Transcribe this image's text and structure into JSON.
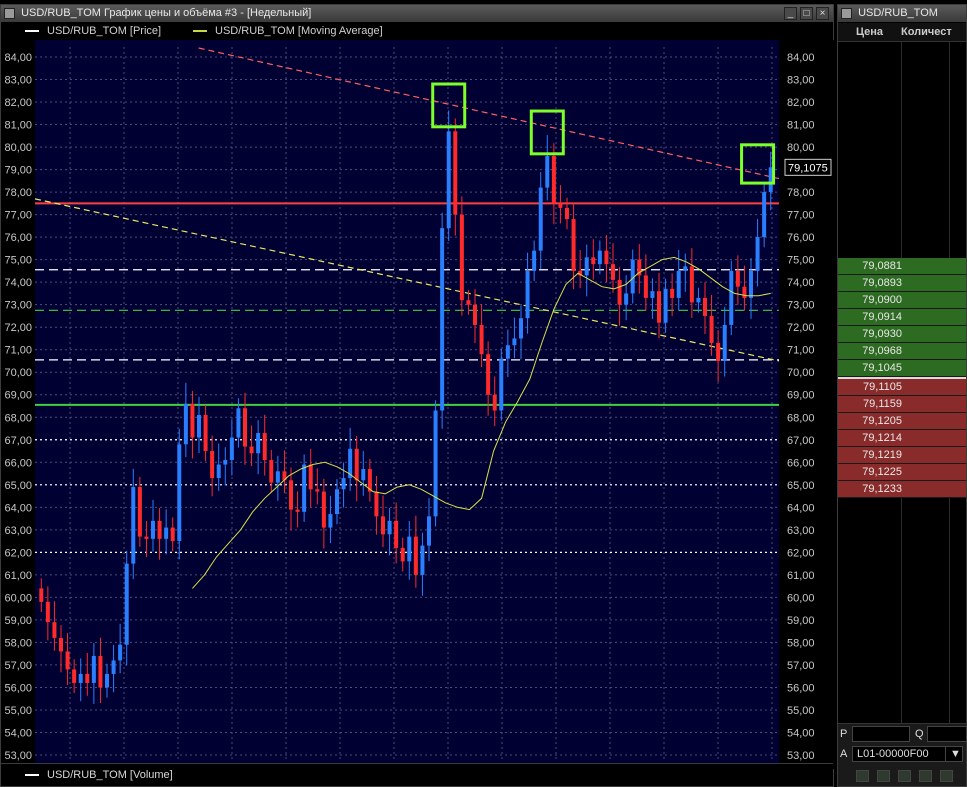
{
  "chart_window": {
    "title": "USD/RUB_TOM График цены и объёма #3 - [Недельный]",
    "legend": [
      {
        "label": "USD/RUB_TOM [Price]",
        "color": "#ffffff"
      },
      {
        "label": "USD/RUB_TOM [Moving Average]",
        "color": "#c8d840"
      }
    ],
    "volume_label": "USD/RUB_TOM [Volume]",
    "last_price": "79,1075"
  },
  "chart_data": {
    "type": "candlestick",
    "ylim": [
      53,
      84
    ],
    "yticks": [
      "53,00",
      "54,00",
      "55,00",
      "56,00",
      "57,00",
      "58,00",
      "59,00",
      "60,00",
      "61,00",
      "62,00",
      "63,00",
      "64,00",
      "65,00",
      "66,00",
      "67,00",
      "68,00",
      "69,00",
      "70,00",
      "71,00",
      "72,00",
      "73,00",
      "74,00",
      "75,00",
      "76,00",
      "77,00",
      "78,00",
      "79,00",
      "80,00",
      "81,00",
      "82,00",
      "83,00",
      "84,00"
    ],
    "close_series": [
      59.8,
      58.9,
      58.2,
      57.6,
      56.8,
      56.2,
      56.6,
      56.2,
      57.4,
      56.0,
      56.6,
      57.2,
      57.9,
      61.5,
      64.9,
      62.7,
      62.6,
      63.4,
      62.6,
      63.1,
      62.5,
      66.8,
      68.6,
      67.1,
      68.1,
      66.5,
      65.3,
      65.9,
      66.1,
      67.1,
      68.4,
      66.7,
      66.4,
      67.3,
      66.1,
      65.1,
      65.6,
      65.2,
      63.9,
      63.8,
      65.9,
      64.8,
      64.7,
      63.1,
      63.7,
      64.8,
      65.3,
      66.6,
      65.2,
      65.7,
      64.7,
      63.6,
      62.8,
      63.4,
      62.2,
      61.6,
      62.7,
      61.0,
      62.3,
      63.6,
      68.3,
      76.4,
      80.7,
      77.0,
      73.2,
      73.0,
      72.1,
      70.8,
      69.0,
      68.3,
      70.6,
      71.2,
      71.5,
      72.4,
      74.5,
      75.4,
      78.2,
      79.6,
      77.5,
      77.3,
      76.8,
      74.5,
      74.3,
      75.1,
      74.8,
      75.4,
      74.8,
      74.1,
      73.0,
      73.5,
      75.0,
      74.3,
      73.3,
      73.6,
      72.2,
      73.7,
      73.3,
      74.5,
      74.7,
      73.1,
      73.3,
      72.5,
      71.3,
      70.5,
      72.1,
      74.5,
      73.8,
      73.3,
      74.5,
      76.0,
      78.0,
      79.1
    ],
    "moving_average": [
      60.4,
      61.0,
      61.8,
      62.4,
      63.0,
      63.8,
      64.4,
      64.9,
      65.4,
      65.7,
      65.9,
      66.0,
      65.8,
      65.5,
      65.1,
      64.7,
      64.6,
      64.9,
      65.0,
      64.8,
      64.5,
      64.2,
      64.0,
      63.9,
      64.4,
      66.5,
      67.8,
      68.7,
      69.7,
      71.3,
      72.8,
      73.9,
      74.4,
      74.1,
      73.8,
      73.7,
      73.9,
      74.4,
      74.7,
      75.0,
      75.1,
      74.9,
      74.6,
      74.2,
      73.8,
      73.5,
      73.4,
      73.4,
      73.5
    ],
    "horizontal_levels": [
      {
        "y": 77.5,
        "color": "#ff4040",
        "style": "solid"
      },
      {
        "y": 68.55,
        "color": "#40d040",
        "style": "solid"
      },
      {
        "y": 74.55,
        "color": "#ffffff",
        "style": "dashed"
      },
      {
        "y": 72.75,
        "color": "#40d040",
        "style": "dashed"
      },
      {
        "y": 70.55,
        "color": "#ffffff",
        "style": "dashed"
      },
      {
        "y": 67.0,
        "color": "#ffffff",
        "style": "dotted"
      },
      {
        "y": 65.0,
        "color": "#ffffff",
        "style": "dotted"
      },
      {
        "y": 62.0,
        "color": "#ffffff",
        "style": "dotted"
      }
    ],
    "trend_lines": [
      {
        "from": [
          0.22,
          84.4
        ],
        "to": [
          1.0,
          78.6
        ],
        "color": "#ff6060",
        "style": "dashed"
      },
      {
        "from": [
          0.0,
          77.7
        ],
        "to": [
          1.0,
          70.5
        ],
        "color": "#e8e860",
        "style": "dashed"
      }
    ],
    "highlight_boxes": [
      {
        "x_index": 62,
        "y_range": [
          80.9,
          82.8
        ]
      },
      {
        "x_index": 77,
        "y_range": [
          79.7,
          81.6
        ]
      },
      {
        "x_index": 109,
        "y_range": [
          78.4,
          80.1
        ]
      }
    ]
  },
  "order_book": {
    "title": "USD/RUB_TOM",
    "columns": [
      "Цена",
      "Количест"
    ],
    "asks": [
      "79,0881",
      "79,0893",
      "79,0900",
      "79,0914",
      "79,0930",
      "79,0968",
      "79,1045"
    ],
    "bids": [
      "79,1105",
      "79,1159",
      "79,1205",
      "79,1214",
      "79,1219",
      "79,1225",
      "79,1233"
    ],
    "ask_color": "#2e6b22",
    "bid_color": "#8a2b2b",
    "labels": {
      "p": "P",
      "q": "Q",
      "a": "A"
    },
    "account": "L01-00000F00"
  }
}
